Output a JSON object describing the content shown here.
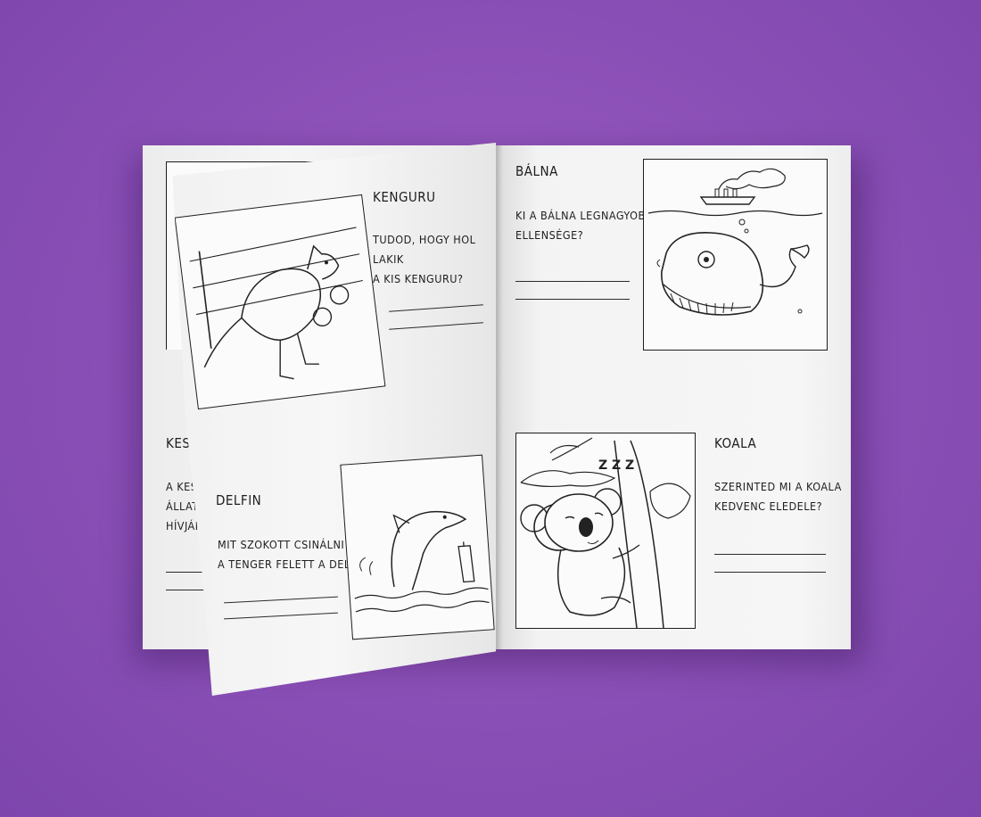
{
  "book": {
    "left_under": {
      "title_partial": "KESEL",
      "text_lines_partial": [
        "A KESEL",
        "ÁLLATOK",
        "HÍVJÁK"
      ]
    },
    "kenguru": {
      "title": "KENGURU",
      "question_lines": [
        "TUDOD, HOGY HOL LAKIK",
        "A KIS KENGURU?"
      ]
    },
    "delfin": {
      "title": "DELFIN",
      "question_lines": [
        "MIT SZOKOTT CSINÁLNI",
        "A TENGER FELETT A DELFIN?"
      ]
    },
    "balna": {
      "title": "BÁLNA",
      "question_lines": [
        "KI A BÁLNA LEGNAGYOBB",
        "ELLENSÉGE?"
      ]
    },
    "koala": {
      "title": "KOALA",
      "question_lines": [
        "SZERINTED MI A KOALA",
        "KEDVENC ELEDELE?"
      ],
      "sleep_text": "Z Z Z"
    }
  },
  "colors": {
    "background": "#8a4fb6",
    "paper": "#f3f3f3",
    "ink": "#1d1d1d"
  }
}
